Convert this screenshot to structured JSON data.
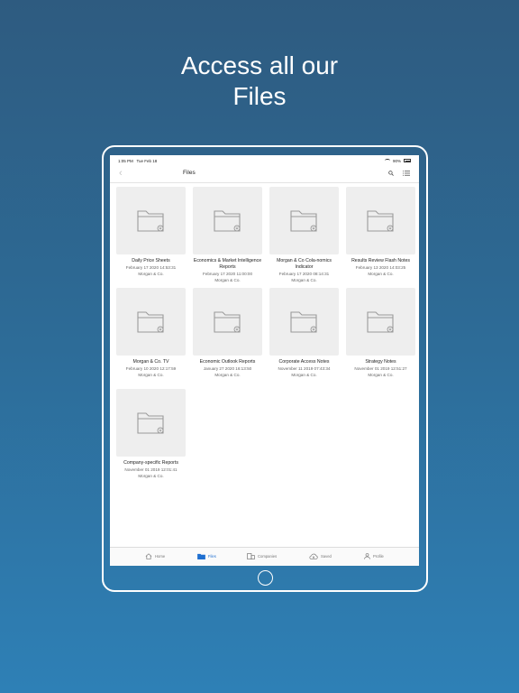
{
  "headline": [
    "Access all our",
    "Files"
  ],
  "status_bar": {
    "time": "1:05 PM",
    "date": "Tue Feb 18",
    "battery": "90%"
  },
  "nav": {
    "back_icon": "chevron-left-icon",
    "title": "Files",
    "search_icon": "search-icon",
    "list_icon": "list-view-icon"
  },
  "files": [
    {
      "name": "Daily Price Sheets",
      "date": "February 17 2020 14:53:31",
      "owner": "Morgan & Co."
    },
    {
      "name": "Economics & Market Intelligence Reports",
      "date": "February 17 2020 11:00:00",
      "owner": "Morgan & Co."
    },
    {
      "name": "Morgan & Co Cola-nomics Indicator",
      "date": "February 17 2020 08:14:31",
      "owner": "Morgan & Co."
    },
    {
      "name": "Results Review Flash Notes",
      "date": "February 13 2020 14:03:25",
      "owner": "Morgan & Co."
    },
    {
      "name": "Morgan & Co. TV",
      "date": "February 10 2020 12:17:59",
      "owner": "Morgan & Co."
    },
    {
      "name": "Economic Outlook Reports",
      "date": "January 27 2020 16:13:50",
      "owner": "Morgan & Co."
    },
    {
      "name": "Corporate Access Notes",
      "date": "November 11 2019 07:43:34",
      "owner": "Morgan & Co."
    },
    {
      "name": "Strategy Notes",
      "date": "November 01 2019 12:51:27",
      "owner": "Morgan & Co."
    },
    {
      "name": "Company-specific Reports",
      "date": "November 01 2019 12:01:41",
      "owner": "Morgan & Co."
    }
  ],
  "tabs": [
    {
      "label": "Home",
      "icon": "home-icon"
    },
    {
      "label": "Files",
      "icon": "folder-icon",
      "active": true
    },
    {
      "label": "Companies",
      "icon": "building-icon"
    },
    {
      "label": "Saved",
      "icon": "cloud-download-icon"
    },
    {
      "label": "Profile",
      "icon": "person-icon"
    }
  ],
  "colors": {
    "accent": "#1f6fd0",
    "thumb_bg": "#eeeeee",
    "bg_top": "#2e5b80",
    "bg_bottom": "#2e80b6"
  }
}
